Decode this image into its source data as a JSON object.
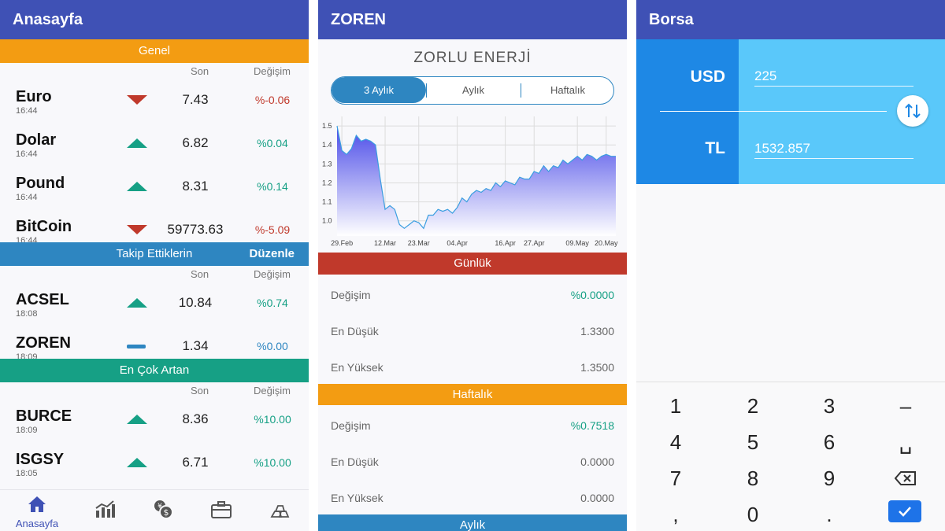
{
  "panel1": {
    "title": "Anasayfa",
    "sections": [
      {
        "title": "Genel",
        "color": "#f39c12",
        "col_son": "Son",
        "col_degisim": "Değişim",
        "rows": [
          {
            "name": "Euro",
            "time": "16:44",
            "trend": "down",
            "value": "7.43",
            "change": "%-0.06"
          },
          {
            "name": "Dolar",
            "time": "16:44",
            "trend": "up",
            "value": "6.82",
            "change": "%0.04"
          },
          {
            "name": "Pound",
            "time": "16:44",
            "trend": "up",
            "value": "8.31",
            "change": "%0.14"
          },
          {
            "name": "BitCoin",
            "time": "16:44",
            "trend": "down",
            "value": "59773.63",
            "change": "%-5.09"
          }
        ]
      },
      {
        "title": "Takip Ettiklerin",
        "edit_label": "Düzenle",
        "color": "#2e86c1",
        "col_son": "Son",
        "col_degisim": "Değişim",
        "rows": [
          {
            "name": "ACSEL",
            "time": "18:08",
            "trend": "up",
            "value": "10.84",
            "change": "%0.74"
          },
          {
            "name": "ZOREN",
            "time": "18:09",
            "trend": "flat",
            "value": "1.34",
            "change": "%0.00"
          }
        ]
      },
      {
        "title": "En Çok Artan",
        "color": "#16a085",
        "col_son": "Son",
        "col_degisim": "Değişim",
        "rows": [
          {
            "name": "BURCE",
            "time": "18:09",
            "trend": "up",
            "value": "8.36",
            "change": "%10.00"
          },
          {
            "name": "ISGSY",
            "time": "18:05",
            "trend": "up",
            "value": "6.71",
            "change": "%10.00"
          }
        ]
      }
    ],
    "bottom_nav": {
      "home_label": "Anasayfa",
      "items": [
        "home-icon",
        "chart-icon",
        "currency-exchange-icon",
        "briefcase-icon",
        "gold-bars-icon"
      ]
    }
  },
  "panel2": {
    "title": "ZOREN",
    "company": "ZORLU ENERJİ",
    "periods": [
      "3 Aylık",
      "Aylık",
      "Haftalık"
    ],
    "active_period": "3 Aylık",
    "daily": {
      "header": "Günlük",
      "rows": [
        {
          "label": "Değişim",
          "value": "%0.0000",
          "color": "#16a085"
        },
        {
          "label": "En Düşük",
          "value": "1.3300"
        },
        {
          "label": "En Yüksek",
          "value": "1.3500"
        }
      ]
    },
    "weekly": {
      "header": "Haftalık",
      "rows": [
        {
          "label": "Değişim",
          "value": "%0.7518",
          "color": "#16a085"
        },
        {
          "label": "En Düşük",
          "value": "0.0000"
        },
        {
          "label": "En Yüksek",
          "value": "0.0000"
        }
      ]
    },
    "monthly_header": "Aylık"
  },
  "chart_data": {
    "type": "area",
    "title": "",
    "xlabel": "",
    "ylabel": "",
    "ylim": [
      0.92,
      1.55
    ],
    "yticks": [
      "1.0",
      "1.1",
      "1.2",
      "1.3",
      "1.4",
      "1.5"
    ],
    "xticks": [
      "29.Feb",
      "12.Mar",
      "23.Mar",
      "04.Apr",
      "16.Apr",
      "27.Apr",
      "09.May",
      "20.May"
    ],
    "grid": true,
    "x": [
      "28.Feb",
      "29.Feb",
      "02.Mar",
      "03.Mar",
      "04.Mar",
      "05.Mar",
      "06.Mar",
      "09.Mar",
      "10.Mar",
      "11.Mar",
      "12.Mar",
      "13.Mar",
      "16.Mar",
      "17.Mar",
      "18.Mar",
      "19.Mar",
      "20.Mar",
      "23.Mar",
      "24.Mar",
      "25.Mar",
      "26.Mar",
      "27.Mar",
      "30.Mar",
      "31.Mar",
      "01.Apr",
      "02.Apr",
      "03.Apr",
      "06.Apr",
      "07.Apr",
      "08.Apr",
      "09.Apr",
      "10.Apr",
      "13.Apr",
      "14.Apr",
      "15.Apr",
      "16.Apr",
      "17.Apr",
      "20.Apr",
      "21.Apr",
      "22.Apr",
      "24.Apr",
      "27.Apr",
      "28.Apr",
      "29.Apr",
      "30.Apr",
      "04.May",
      "05.May",
      "06.May",
      "07.May",
      "08.May",
      "11.May",
      "12.May",
      "13.May",
      "14.May",
      "15.May",
      "18.May",
      "20.May",
      "21.May",
      "22.May"
    ],
    "values": [
      1.5,
      1.37,
      1.35,
      1.38,
      1.45,
      1.42,
      1.43,
      1.42,
      1.4,
      1.22,
      1.06,
      1.08,
      1.06,
      0.98,
      0.96,
      0.98,
      1.0,
      0.99,
      0.96,
      1.03,
      1.03,
      1.06,
      1.05,
      1.06,
      1.04,
      1.07,
      1.12,
      1.1,
      1.14,
      1.16,
      1.15,
      1.17,
      1.16,
      1.2,
      1.18,
      1.21,
      1.2,
      1.19,
      1.23,
      1.22,
      1.22,
      1.26,
      1.25,
      1.29,
      1.26,
      1.29,
      1.28,
      1.32,
      1.3,
      1.32,
      1.34,
      1.32,
      1.35,
      1.34,
      1.32,
      1.34,
      1.35,
      1.34,
      1.34
    ],
    "fill_top": "#4a4ae8",
    "fill_bottom": "#ffffff",
    "line_color": "#3a9ee0"
  },
  "panel3": {
    "title": "Borsa",
    "from_currency": "USD",
    "from_value": "225",
    "to_currency": "TL",
    "to_value": "1532.857",
    "keys": [
      [
        "1",
        "2",
        "3",
        "–"
      ],
      [
        "4",
        "5",
        "6",
        "␣"
      ],
      [
        "7",
        "8",
        "9",
        "backspace-icon"
      ],
      [
        ",",
        "0",
        ".",
        "check-icon"
      ]
    ]
  },
  "colors": {
    "appbar": "#3f51b5",
    "up": "#16a085",
    "down": "#c0392b",
    "flat": "#2e86c1",
    "conv_dark": "#1e88e5",
    "conv_light": "#5ac8fa"
  }
}
